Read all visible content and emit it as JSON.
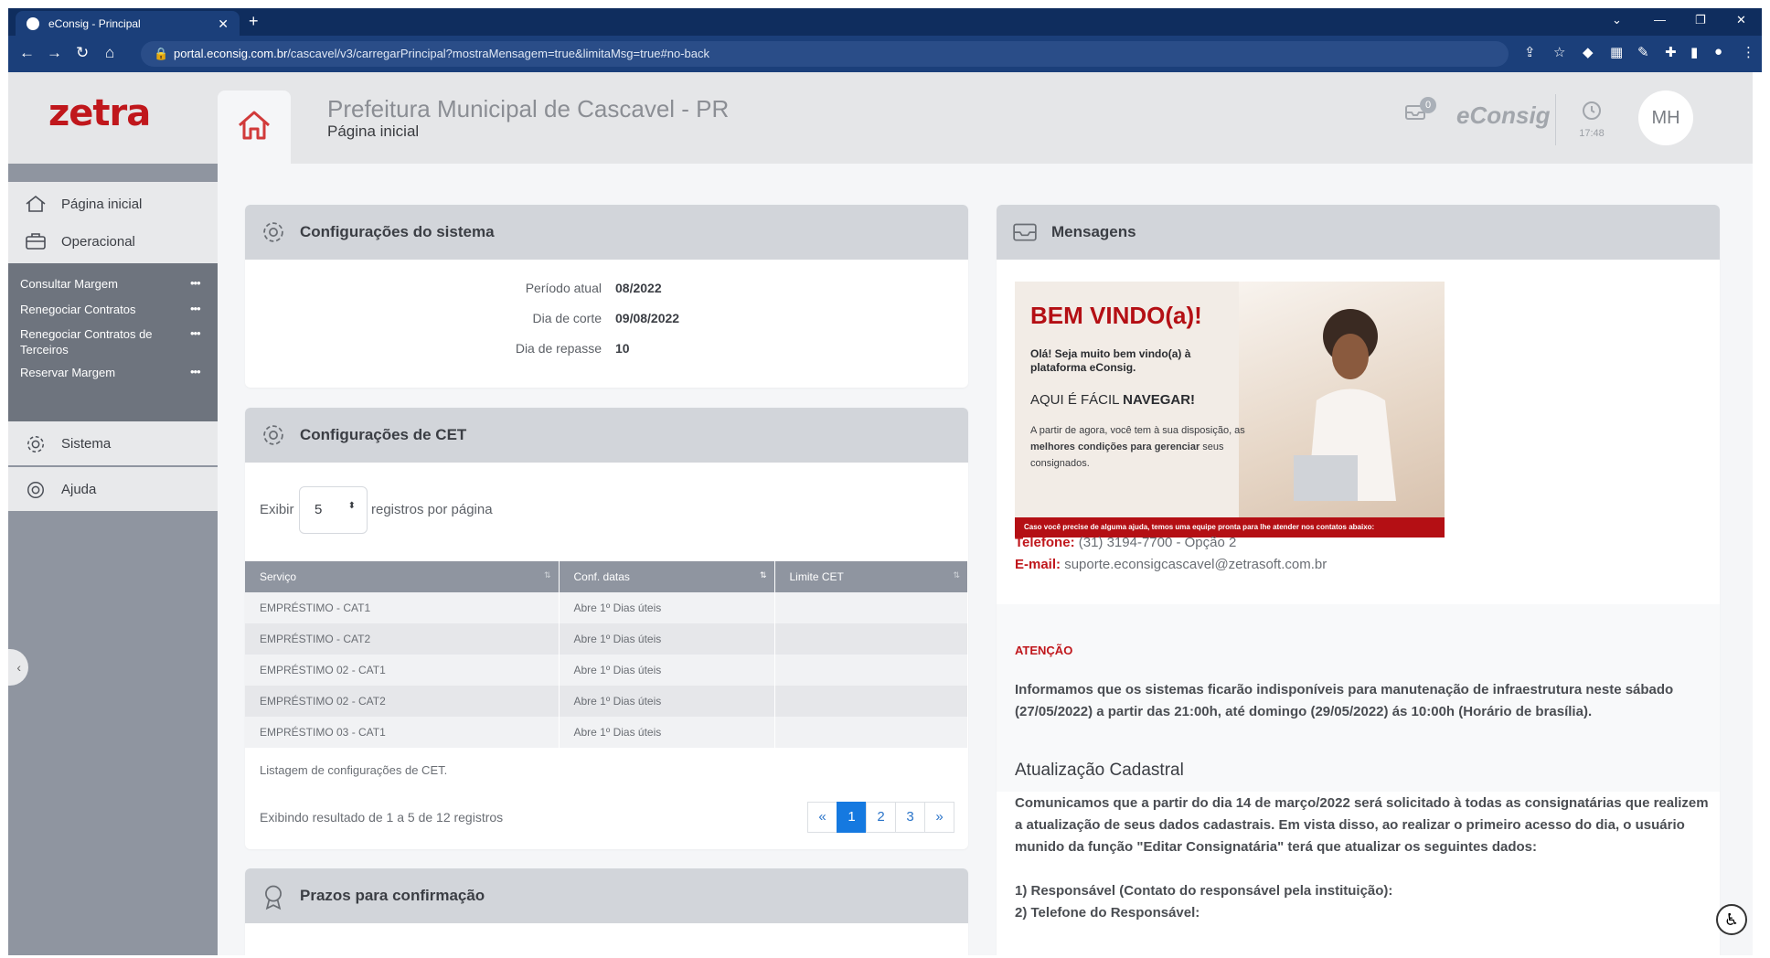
{
  "browser": {
    "tab_title": "eConsig - Principal",
    "url_host": "portal.econsig.com.br",
    "url_path": "/cascavel/v3/carregarPrincipal?mostraMensagem=true&limitaMsg=true#no-back"
  },
  "header": {
    "logo": "zetra",
    "institution": "Prefeitura Municipal de Cascavel - PR",
    "page_name": "Página inicial",
    "mail_count": "0",
    "brand": "eConsig",
    "time": "17:48",
    "avatar": "MH"
  },
  "sidebar": {
    "home": "Página inicial",
    "operational": "Operacional",
    "sub_items": [
      "Consultar Margem",
      "Renegociar Contratos",
      "Renegociar Contratos de Terceiros",
      "Reservar Margem"
    ],
    "system": "Sistema",
    "help": "Ajuda"
  },
  "system_config": {
    "title": "Configurações do sistema",
    "rows": [
      {
        "label": "Período atual",
        "value": "08/2022"
      },
      {
        "label": "Dia de corte",
        "value": "09/08/2022"
      },
      {
        "label": "Dia de repasse",
        "value": "10"
      }
    ]
  },
  "cet": {
    "title": "Configurações de CET",
    "show_label": "Exibir",
    "page_size": "5",
    "per_page_label": "registros por página",
    "columns": [
      "Serviço",
      "Conf. datas",
      "Limite CET"
    ],
    "rows": [
      [
        "EMPRÉSTIMO - CAT1",
        "Abre 1º Dias úteis",
        ""
      ],
      [
        "EMPRÉSTIMO - CAT2",
        "Abre 1º Dias úteis",
        ""
      ],
      [
        "EMPRÉSTIMO 02 - CAT1",
        "Abre 1º Dias úteis",
        ""
      ],
      [
        "EMPRÉSTIMO 02 - CAT2",
        "Abre 1º Dias úteis",
        ""
      ],
      [
        "EMPRÉSTIMO 03 - CAT1",
        "Abre 1º Dias úteis",
        ""
      ]
    ],
    "caption": "Listagem de configurações de CET.",
    "result": "Exibindo resultado de 1 a 5 de 12 registros",
    "pages": [
      "«",
      "1",
      "2",
      "3",
      "»"
    ]
  },
  "deadlines": {
    "title": "Prazos para confirmação"
  },
  "messages": {
    "title": "Mensagens",
    "banner_title": "BEM VINDO(a)!",
    "banner_greeting": "Olá! Seja muito bem vindo(a) à plataforma eConsig.",
    "banner_nav_pre": "AQUI É FÁCIL ",
    "banner_nav_bold": "NAVEGAR!",
    "banner_text_pre": "A partir de agora, você tem à sua disposição, as ",
    "banner_text_bold": "melhores condições para gerenciar",
    "banner_text_post": " seus consignados.",
    "banner_strip": "Caso você precise de alguma ajuda, temos uma equipe pronta para lhe atender nos contatos abaixo:",
    "phone_label": "Telefone:",
    "phone": "(31) 3194-7700 - Opção 2",
    "email_label": "E-mail:",
    "email": "suporte.econsigcascavel@zetrasoft.com.br",
    "attention": "ATENÇÃO",
    "attention_text": "Informamos que os sistemas ficarão indisponíveis para manutenação de infraestrutura neste sábado (27/05/2022) a partir das 21:00h, até domingo (29/05/2022) ás 10:00h (Horário de brasília).",
    "update_title": "Atualização Cadastral",
    "update_text": "Comunicamos que a partir do dia 14 de março/2022 será solicitado à todas as consignatárias que realizem a atualização de seus dados cadastrais. Em vista disso, ao realizar o primeiro acesso do dia, o usuário munido da função \"Editar Consignatária\" terá que atualizar os seguintes dados:",
    "update_items": [
      "1) Responsável (Contato do responsável pela instituição):",
      "2) Telefone do Responsável:"
    ]
  }
}
